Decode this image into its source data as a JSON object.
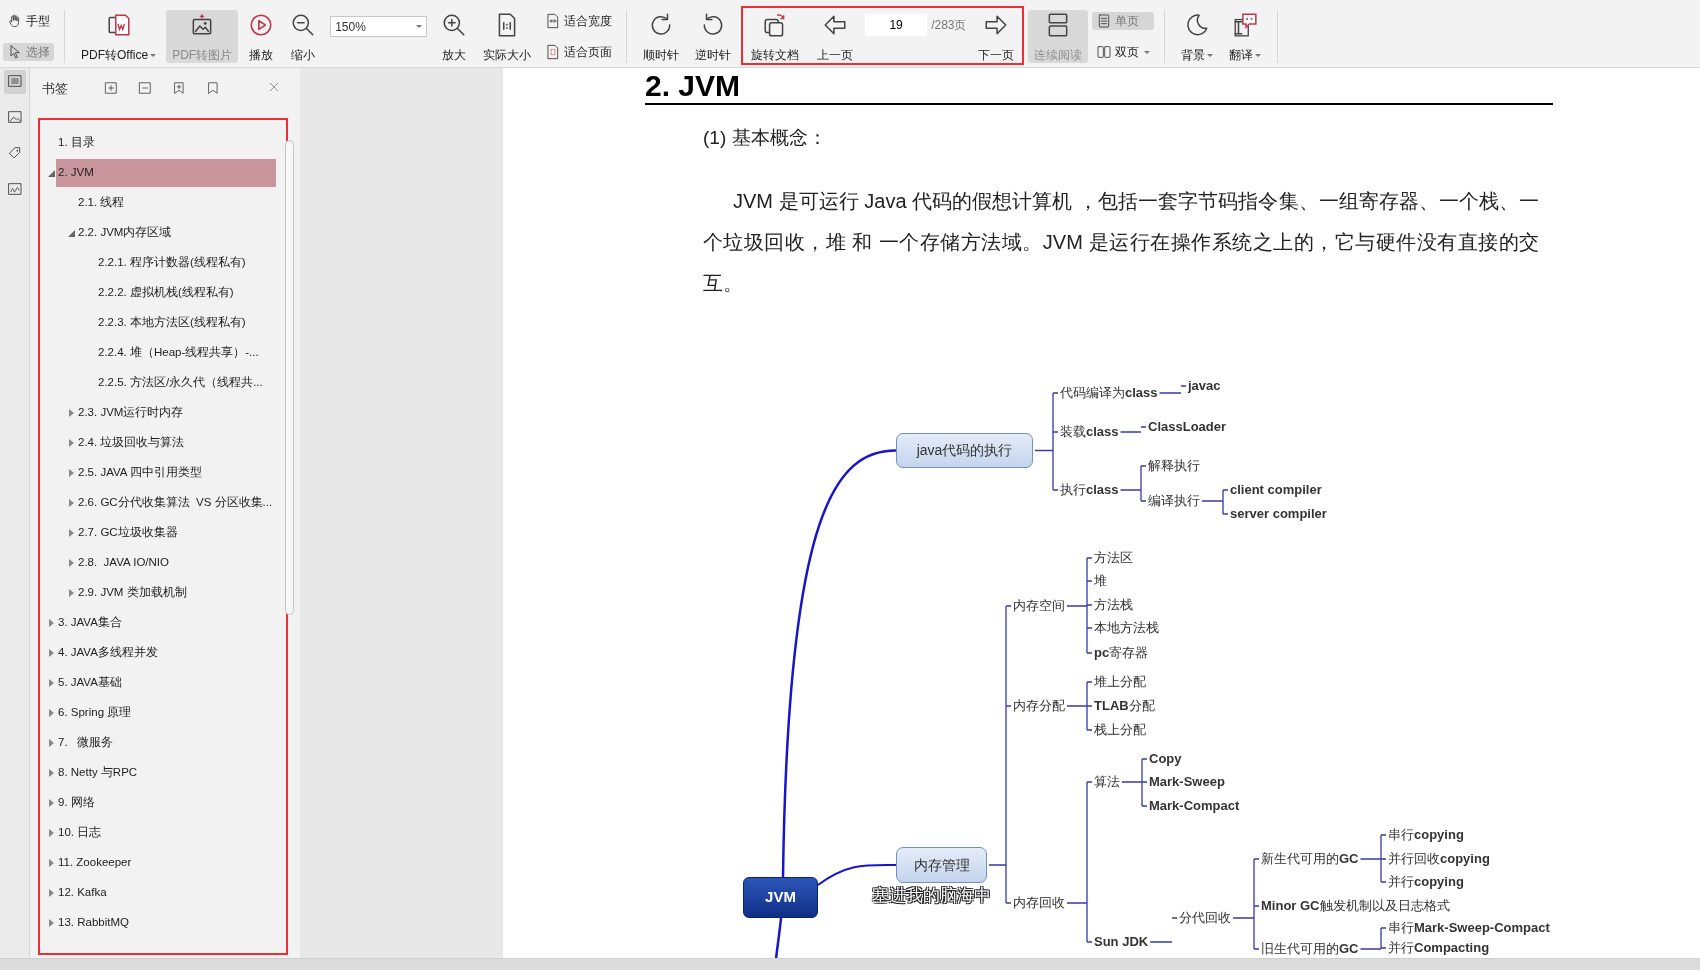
{
  "toolbar": [
    {
      "kind": "stack",
      "items": [
        {
          "label": "手型",
          "selected": false
        },
        {
          "label": "选择",
          "selected": true
        }
      ]
    },
    {
      "kind": "separator"
    },
    {
      "kind": "big",
      "label": "PDF转Office",
      "selected": false,
      "dropdown": true
    },
    {
      "kind": "big",
      "label": "PDF转图片",
      "selected": true
    },
    {
      "kind": "big",
      "label": "播放",
      "selected": false
    },
    {
      "kind": "big",
      "label": "缩小",
      "selected": false
    },
    {
      "kind": "select",
      "value": "150%"
    },
    {
      "kind": "big",
      "label": "放大",
      "selected": false
    },
    {
      "kind": "big",
      "label": "实际大小",
      "selected": false
    },
    {
      "kind": "stack",
      "items": [
        {
          "label": "适合宽度",
          "selected": false
        },
        {
          "label": "适合页面",
          "selected": false
        }
      ]
    },
    {
      "kind": "separator"
    },
    {
      "kind": "big",
      "label": "顺时针",
      "selected": false
    },
    {
      "kind": "big",
      "label": "逆时针",
      "selected": false
    },
    {
      "kind": "group",
      "highlighted": true,
      "items": [
        {
          "kind": "big",
          "label": "旋转文档",
          "selected": false
        },
        {
          "kind": "big",
          "label": "上一页",
          "selected": false
        },
        {
          "kind": "page",
          "value": "19",
          "total": "/283页"
        },
        {
          "kind": "big",
          "label": "下一页",
          "selected": false
        }
      ]
    },
    {
      "kind": "big",
      "label": "连续阅读",
      "selected": true
    },
    {
      "kind": "stack",
      "items": [
        {
          "label": "单页",
          "selected": true
        },
        {
          "label": "双页",
          "selected": false,
          "dropdown": true
        }
      ]
    },
    {
      "kind": "separator"
    },
    {
      "kind": "big",
      "label": "背景",
      "selected": false,
      "dropdown": true
    },
    {
      "kind": "big",
      "label": "翻译",
      "selected": false,
      "dropdown": true
    },
    {
      "kind": "separator"
    }
  ],
  "side_strip": [
    {
      "selected": true
    },
    {
      "selected": false
    },
    {
      "selected": false
    },
    {
      "selected": false
    }
  ],
  "bookmarks": {
    "title": "书签",
    "highlighted": true,
    "items": [
      {
        "label": "1. 目录",
        "selected": false
      },
      {
        "label": "2. JVM",
        "expanded": true,
        "selected": true,
        "children": [
          {
            "label": "2.1. 线程",
            "selected": false
          },
          {
            "label": "2.2. JVM内存区域",
            "expanded": true,
            "selected": false,
            "children": [
              {
                "label": "2.2.1. 程序计数器(线程私有)",
                "selected": false
              },
              {
                "label": "2.2.2. 虚拟机栈(线程私有)",
                "selected": false
              },
              {
                "label": "2.2.3. 本地方法区(线程私有)",
                "selected": false
              },
              {
                "label": "2.2.4. 堆（Heap-线程共享）-...",
                "selected": false
              },
              {
                "label": "2.2.5. 方法区/永久代（线程共...",
                "selected": false
              }
            ]
          },
          {
            "label": "2.3. JVM运行时内存",
            "expanded": false,
            "selected": false
          },
          {
            "label": "2.4. 垃圾回收与算法",
            "expanded": false,
            "selected": false
          },
          {
            "label": "2.5. JAVA 四中引用类型",
            "expanded": false,
            "selected": false
          },
          {
            "label": "2.6. GC分代收集算法  VS 分区收集...",
            "expanded": false,
            "selected": false
          },
          {
            "label": "2.7. GC垃圾收集器",
            "expanded": false,
            "selected": false
          },
          {
            "label": "2.8.  JAVA IO/NIO",
            "expanded": false,
            "selected": false
          },
          {
            "label": "2.9. JVM 类加载机制",
            "expanded": false,
            "selected": false
          }
        ]
      },
      {
        "label": "3. JAVA集合",
        "expanded": false,
        "selected": false
      },
      {
        "label": "4. JAVA多线程并发",
        "expanded": false,
        "selected": false
      },
      {
        "label": "5. JAVA基础",
        "expanded": false,
        "selected": false
      },
      {
        "label": "6. Spring 原理",
        "expanded": false,
        "selected": false
      },
      {
        "label": "7.   微服务",
        "expanded": false,
        "selected": false
      },
      {
        "label": "8. Netty 与RPC",
        "expanded": false,
        "selected": false
      },
      {
        "label": "9. 网络",
        "expanded": false,
        "selected": false
      },
      {
        "label": "10. 日志",
        "expanded": false,
        "selected": false
      },
      {
        "label": "11. Zookeeper",
        "expanded": false,
        "selected": false
      },
      {
        "label": "12. Kafka",
        "expanded": false,
        "selected": false
      },
      {
        "label": "13. RabbitMQ",
        "expanded": false,
        "selected": false
      }
    ]
  },
  "page": {
    "heading": "2. JVM",
    "subheading": "(1) 基本概念：",
    "paragraph": "JVM 是可运行 Java 代码的假想计算机 ，包括一套字节码指令集、一组寄存器、一个栈、一个垃圾回收，堆 和 一个存储方法域。JVM 是运行在操作系统之上的，它与硬件没有直接的交互。",
    "mindmap": {
      "label": "JVM",
      "kind": "root",
      "children": [
        {
          "label": "java代码的执行",
          "kind": "topic",
          "children": [
            {
              "label": "代码编译为**class**",
              "children": [
                {
                  "label": "javac",
                  "bold": true
                }
              ]
            },
            {
              "label": "装载**class**",
              "children": [
                {
                  "label": "ClassLoader",
                  "bold": true
                }
              ]
            },
            {
              "label": "执行**class**",
              "children": [
                {
                  "label": "解释执行"
                },
                {
                  "label": "编译执行",
                  "children": [
                    {
                      "label": "client compiler",
                      "bold": true
                    },
                    {
                      "label": "server compiler",
                      "bold": true
                    }
                  ]
                }
              ]
            }
          ]
        },
        {
          "label": "内存管理",
          "kind": "topic",
          "children": [
            {
              "label": "内存空间",
              "children": [
                {
                  "label": "方法区"
                },
                {
                  "label": "堆"
                },
                {
                  "label": "方法栈"
                },
                {
                  "label": "本地方法栈"
                },
                {
                  "label": "**pc**寄存器"
                }
              ]
            },
            {
              "label": "内存分配",
              "children": [
                {
                  "label": "堆上分配"
                },
                {
                  "label": "**TLAB**分配"
                },
                {
                  "label": "栈上分配"
                }
              ]
            },
            {
              "label": "内存回收",
              "children": [
                {
                  "label": "算法",
                  "children": [
                    {
                      "label": "Copy",
                      "bold": true
                    },
                    {
                      "label": "Mark-Sweep",
                      "bold": true
                    },
                    {
                      "label": "Mark-Compact",
                      "bold": true
                    }
                  ]
                },
                {
                  "label": "Sun JDK",
                  "bold": true,
                  "children": [
                    {
                      "label": "分代回收",
                      "children": [
                        {
                          "label": "新生代可用的**GC**",
                          "children": [
                            {
                              "label": "串行**copying**"
                            },
                            {
                              "label": "并行回收**copying**"
                            },
                            {
                              "label": "并行**copying**"
                            }
                          ]
                        },
                        {
                          "label": "**Minor GC**触发机制以及日志格式"
                        },
                        {
                          "label": "旧生代可用的**GC**",
                          "children": [
                            {
                              "label": "串行**Mark-Sweep-Compact**"
                            },
                            {
                              "label": "并行**Compacting**"
                            }
                          ]
                        }
                      ]
                    }
                  ]
                }
              ]
            }
          ]
        }
      ]
    },
    "caption": "塞进我的脑海中"
  }
}
